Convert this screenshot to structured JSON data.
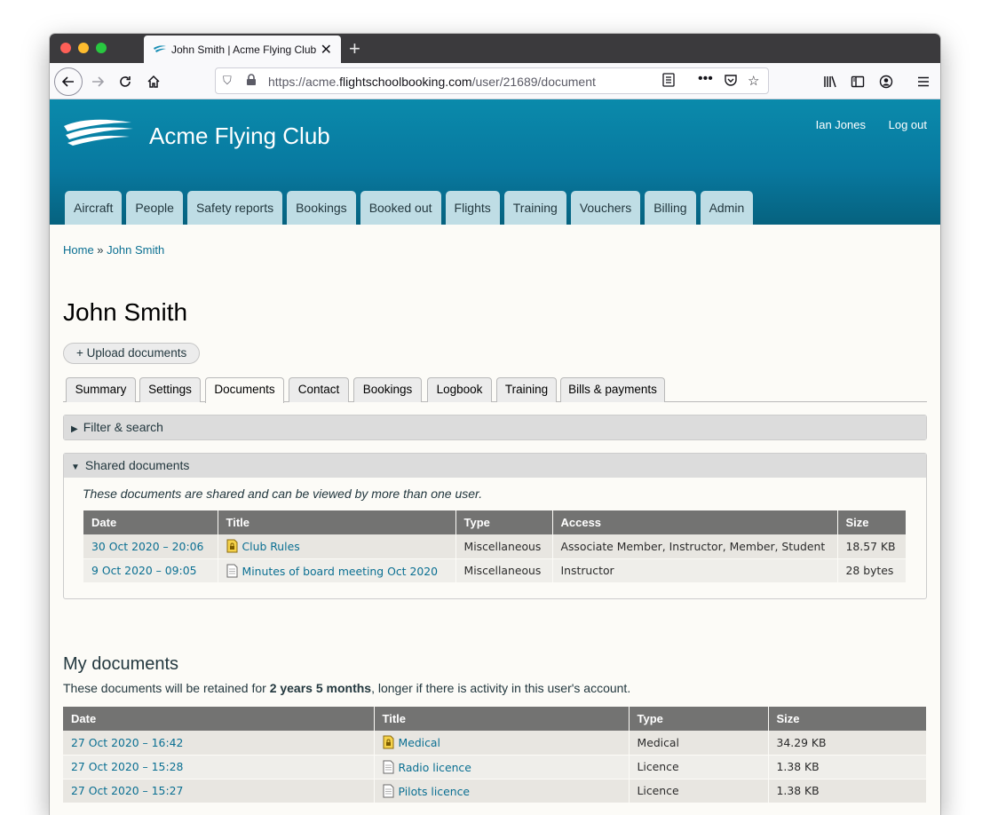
{
  "browser": {
    "tab_title": "John Smith | Acme Flying Club",
    "url_prefix": "https://acme.",
    "url_domain": "flightschoolbooking.com",
    "url_path": "/user/21689/document"
  },
  "site": {
    "name": "Acme Flying Club",
    "user_name": "Ian Jones",
    "logout_label": "Log out",
    "accent_color": "#0a8aab"
  },
  "main_nav": [
    "Aircraft",
    "People",
    "Safety reports",
    "Bookings",
    "Booked out",
    "Flights",
    "Training",
    "Vouchers",
    "Billing",
    "Admin"
  ],
  "breadcrumb": {
    "home": "Home",
    "separator": " » ",
    "current": "John Smith"
  },
  "page": {
    "title": "John Smith",
    "upload_label": "+ Upload documents",
    "tabs": [
      "Summary",
      "Settings",
      "Documents",
      "Contact",
      "Bookings",
      "Logbook",
      "Training",
      "Bills & payments"
    ],
    "active_tab": "Documents"
  },
  "filter": {
    "label": "Filter & search"
  },
  "shared": {
    "label": "Shared documents",
    "note": "These documents are shared and can be viewed by more than one user.",
    "headers": [
      "Date",
      "Title",
      "Type",
      "Access",
      "Size"
    ],
    "rows": [
      {
        "date": "30 Oct 2020 – 20:06",
        "title": "Club Rules",
        "icon": "locked-document-icon",
        "type": "Miscellaneous",
        "access": "Associate Member, Instructor, Member, Student",
        "size": "18.57 KB"
      },
      {
        "date": "9 Oct 2020 – 09:05",
        "title": "Minutes of board meeting Oct 2020",
        "icon": "document-icon",
        "type": "Miscellaneous",
        "access": "Instructor",
        "size": "28 bytes"
      }
    ]
  },
  "my_docs": {
    "title": "My documents",
    "retain_prefix": "These documents will be retained for ",
    "retain_period": "2 years 5 months",
    "retain_suffix": ", longer if there is activity in this user's account.",
    "headers": [
      "Date",
      "Title",
      "Type",
      "Size"
    ],
    "rows": [
      {
        "date": "27 Oct 2020 – 16:42",
        "title": "Medical",
        "icon": "locked-document-icon",
        "type": "Medical",
        "size": "34.29 KB"
      },
      {
        "date": "27 Oct 2020 – 15:28",
        "title": "Radio licence",
        "icon": "document-icon",
        "type": "Licence",
        "size": "1.38 KB"
      },
      {
        "date": "27 Oct 2020 – 15:27",
        "title": "Pilots licence",
        "icon": "document-icon",
        "type": "Licence",
        "size": "1.38 KB"
      }
    ]
  }
}
